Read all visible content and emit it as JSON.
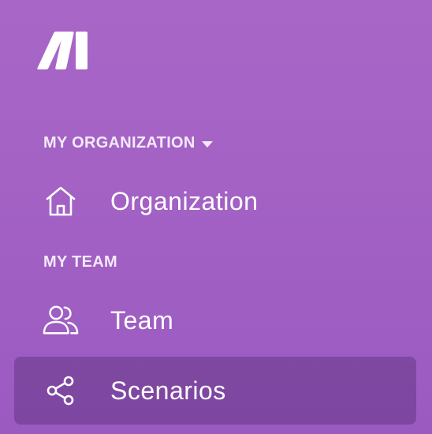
{
  "brand": {
    "logo_icon": "make-logo-icon"
  },
  "sidebar": {
    "org_section": {
      "header": "MY ORGANIZATION",
      "caret_icon": "caret-down-icon"
    },
    "org_items": [
      {
        "label": "Organization",
        "icon": "home-icon"
      }
    ],
    "team_section": {
      "header": "MY TEAM"
    },
    "team_items": [
      {
        "label": "Team",
        "icon": "users-icon"
      },
      {
        "label": "Scenarios",
        "icon": "share-icon",
        "active": true
      }
    ]
  },
  "colors": {
    "background": "#a462c5",
    "active_item_bg": "#7b4a9a",
    "text": "#ffffff",
    "section_header_text": "#f4e9fa"
  }
}
